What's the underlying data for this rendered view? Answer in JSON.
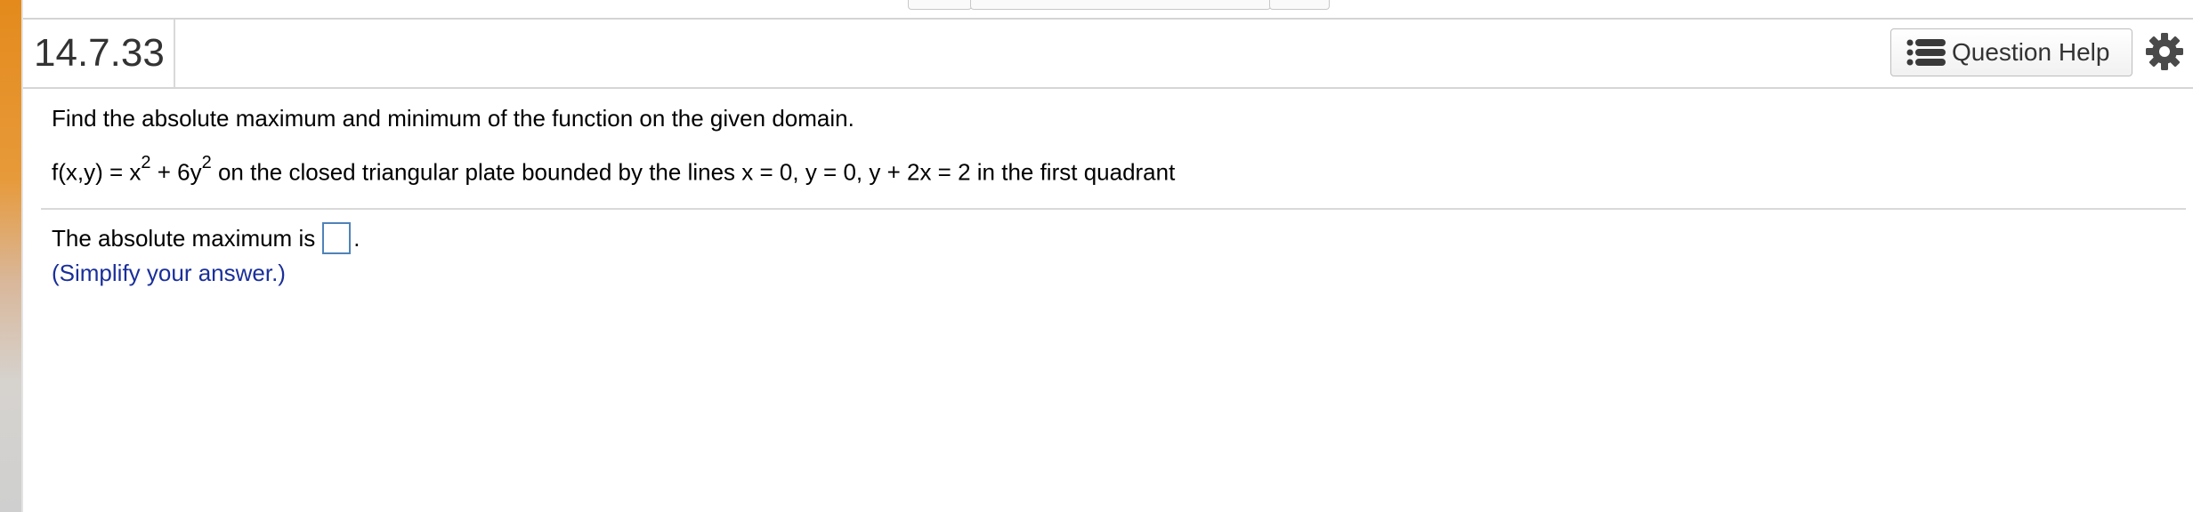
{
  "header": {
    "question_number": "14.7.33",
    "help_button_label": "Question Help"
  },
  "problem": {
    "instruction": "Find the absolute maximum and minimum of the function on the given domain.",
    "function_prefix": "f(x,y) = x",
    "exp1": "2",
    "function_mid": " + 6y",
    "exp2": "2",
    "function_suffix": "  on the closed triangular plate bounded by the lines x = 0, y = 0, y + 2x = 2 in the first quadrant"
  },
  "answer": {
    "prompt": "The absolute maximum is",
    "trailing": ".",
    "value": "",
    "hint": "(Simplify your answer.)"
  },
  "icons": {
    "help": "list-icon",
    "settings": "gear-icon"
  }
}
